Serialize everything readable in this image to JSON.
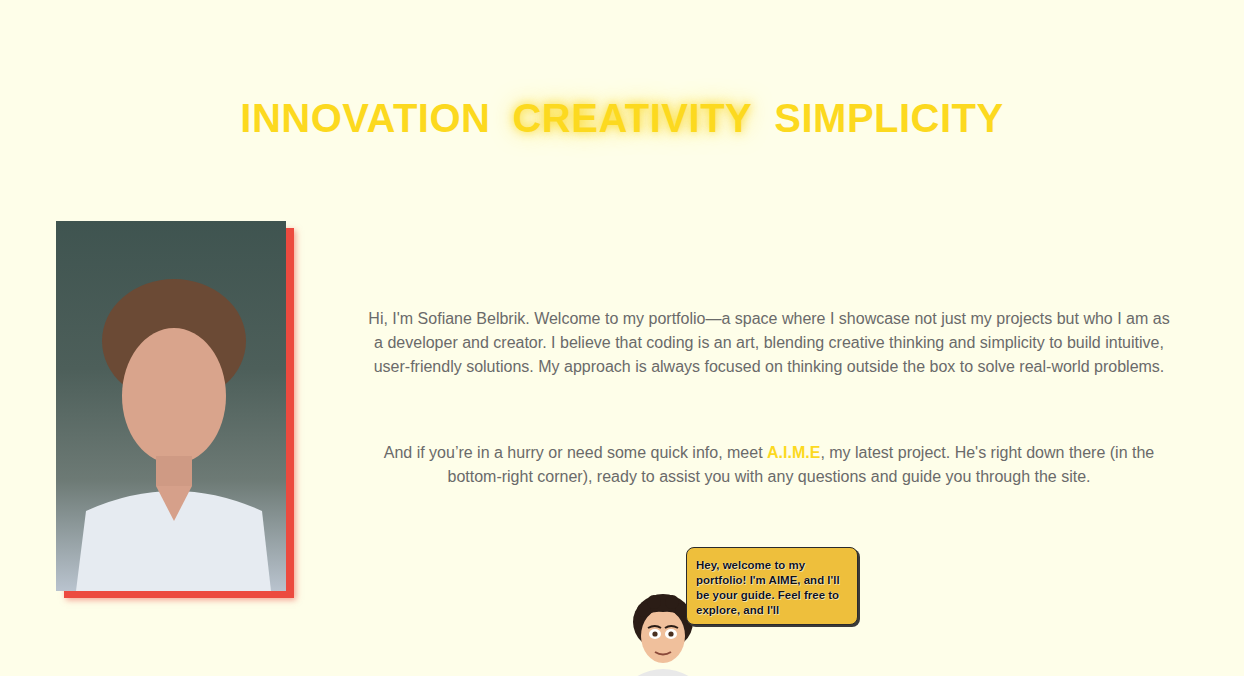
{
  "heading": [
    {
      "label": "INNOVATION",
      "selected": false
    },
    {
      "label": "CREATIVITY",
      "selected": true
    },
    {
      "label": "SIMPLICITY",
      "selected": false
    }
  ],
  "intro": "Hi, I'm Sofiane Belbrik. Welcome to my portfolio—a space where I showcase not just my projects but who I am as a developer and creator. I believe that coding is an art, blending creative thinking and simplicity to build intuitive, user-friendly solutions. My approach is always focused on thinking outside the box to solve real-world problems.",
  "assistant_note": {
    "before": "And if you’re in a hurry or need some quick info, meet ",
    "highlight": "A.I.M.E",
    "after": ", my latest project. He's right down there (in the bottom-right corner), ready to assist you with any questions and guide you through the site."
  },
  "chat_bubble": "Hey, welcome to my portfolio! I'm AIME, and I'll be your guide. Feel free to explore, and I'll"
}
